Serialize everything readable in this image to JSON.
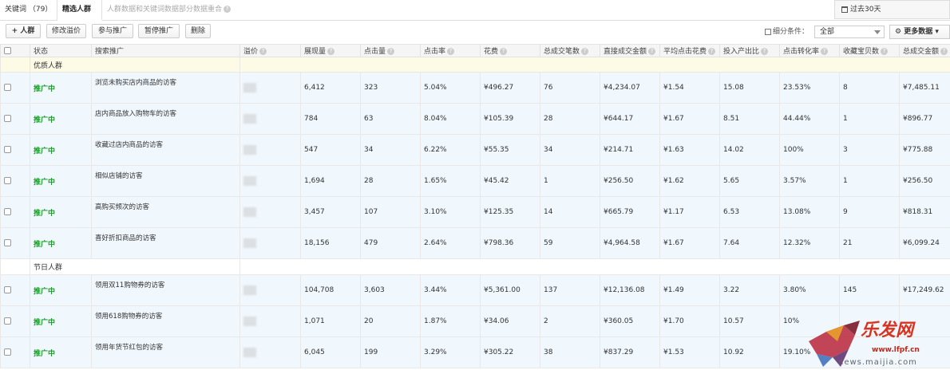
{
  "tabs": {
    "keywords": "关键词 （79）",
    "crowds": "精选人群",
    "notice": "人群数据和关键词数据部分数据重合"
  },
  "period": "过去30天",
  "toolbar": {
    "add_crowd": "+ 人群",
    "modify_premium": "修改溢价",
    "join_promo": "参与推广",
    "pause_promo": "暂停推广",
    "delete": "删除",
    "filter_label": "细分条件：",
    "filter_value": "全部",
    "more_data": "更多数据"
  },
  "columns": [
    "状态",
    "搜索推广",
    "溢价",
    "展现量",
    "点击量",
    "点击率",
    "花费",
    "总成交笔数",
    "直接成交金额",
    "平均点击花费",
    "投入产出比",
    "点击转化率",
    "收藏宝贝数",
    "总成交金额"
  ],
  "groups": [
    {
      "name": "优质人群",
      "rows": [
        {
          "status": "推广中",
          "name": "浏览未购买店内商品的访客",
          "impressions": "6,412",
          "clicks": "323",
          "ctr": "5.04%",
          "cost": "¥496.27",
          "orders": "76",
          "direct_amount": "¥4,234.07",
          "cpc": "¥1.54",
          "roi": "15.08",
          "cvr": "23.53%",
          "fav": "8",
          "total_amount": "¥7,485.11"
        },
        {
          "status": "推广中",
          "name": "店内商品放入购物车的访客",
          "impressions": "784",
          "clicks": "63",
          "ctr": "8.04%",
          "cost": "¥105.39",
          "orders": "28",
          "direct_amount": "¥644.17",
          "cpc": "¥1.67",
          "roi": "8.51",
          "cvr": "44.44%",
          "fav": "1",
          "total_amount": "¥896.77"
        },
        {
          "status": "推广中",
          "name": "收藏过店内商品的访客",
          "impressions": "547",
          "clicks": "34",
          "ctr": "6.22%",
          "cost": "¥55.35",
          "orders": "34",
          "direct_amount": "¥214.71",
          "cpc": "¥1.63",
          "roi": "14.02",
          "cvr": "100%",
          "fav": "3",
          "total_amount": "¥775.88"
        },
        {
          "status": "推广中",
          "name": "相似店铺的访客",
          "impressions": "1,694",
          "clicks": "28",
          "ctr": "1.65%",
          "cost": "¥45.42",
          "orders": "1",
          "direct_amount": "¥256.50",
          "cpc": "¥1.62",
          "roi": "5.65",
          "cvr": "3.57%",
          "fav": "1",
          "total_amount": "¥256.50"
        },
        {
          "status": "推广中",
          "name": "高购买频次的访客",
          "impressions": "3,457",
          "clicks": "107",
          "ctr": "3.10%",
          "cost": "¥125.35",
          "orders": "14",
          "direct_amount": "¥665.79",
          "cpc": "¥1.17",
          "roi": "6.53",
          "cvr": "13.08%",
          "fav": "9",
          "total_amount": "¥818.31"
        },
        {
          "status": "推广中",
          "name": "喜好折扣商品的访客",
          "impressions": "18,156",
          "clicks": "479",
          "ctr": "2.64%",
          "cost": "¥798.36",
          "orders": "59",
          "direct_amount": "¥4,964.58",
          "cpc": "¥1.67",
          "roi": "7.64",
          "cvr": "12.32%",
          "fav": "21",
          "total_amount": "¥6,099.24"
        }
      ]
    },
    {
      "name": "节日人群",
      "rows": [
        {
          "status": "推广中",
          "name": "领用双11购物券的访客",
          "impressions": "104,708",
          "clicks": "3,603",
          "ctr": "3.44%",
          "cost": "¥5,361.00",
          "orders": "137",
          "direct_amount": "¥12,136.08",
          "cpc": "¥1.49",
          "roi": "3.22",
          "cvr": "3.80%",
          "fav": "145",
          "total_amount": "¥17,249.62"
        },
        {
          "status": "推广中",
          "name": "领用618购物券的访客",
          "impressions": "1,071",
          "clicks": "20",
          "ctr": "1.87%",
          "cost": "¥34.06",
          "orders": "2",
          "direct_amount": "¥360.05",
          "cpc": "¥1.70",
          "roi": "10.57",
          "cvr": "10%",
          "fav": "",
          "total_amount": ""
        },
        {
          "status": "推广中",
          "name": "领用年货节红包的访客",
          "impressions": "6,045",
          "clicks": "199",
          "ctr": "3.29%",
          "cost": "¥305.22",
          "orders": "38",
          "direct_amount": "¥837.29",
          "cpc": "¥1.53",
          "roi": "10.92",
          "cvr": "19.10%",
          "fav": "",
          "total_amount": ""
        }
      ]
    }
  ],
  "watermark": {
    "logo_text": "乐发网",
    "site": "www.lfpf.cn",
    "url": "news.maijia.com"
  },
  "colors": {
    "status_green": "#1b9c2b",
    "group_bg": "#fdfbe5",
    "row_bg": "#f0f7fd",
    "watermark_red": "#d9331f"
  }
}
